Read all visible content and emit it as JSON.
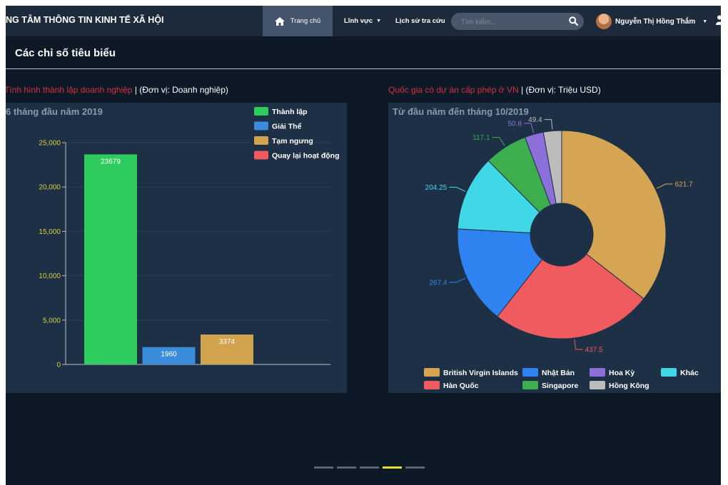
{
  "navbar": {
    "brand": "NG TÂM THÔNG TIN KINH TẾ XÃ HỘI",
    "home_label": "Trang chủ",
    "field_label": "Lĩnh vực",
    "history_label": "Lịch sử tra cứu",
    "search_placeholder": "Tìm kiếm...",
    "user_name": "Nguyễn Thị Hồng Thắm",
    "icons": [
      "home-icon",
      "search-icon",
      "user-icon"
    ]
  },
  "section": {
    "title": "Các chỉ số tiêu biểu"
  },
  "panels": {
    "left": {
      "title_red": "Tình hình thành lập doanh nghiệp",
      "title_rest": " | (Đơn vị: Doanh nghiệp)"
    },
    "right": {
      "title_red": "Quốc gia có dự án cấp phép ở VN",
      "title_rest": " | (Đơn vị: Triệu USD)"
    }
  },
  "colors": {
    "green": "#2ecc5f",
    "blue": "#3b8ddb",
    "gold": "#d1a34e",
    "red": "#ef5a5f",
    "pie_gold": "#d6a553",
    "pie_red": "#ef5b5e",
    "pie_blue": "#2f83f0",
    "pie_cyan": "#40d7e6",
    "pie_green": "#3cae4e",
    "pie_purple": "#8c6fd9",
    "pie_gray": "#bcbcbc"
  },
  "chart_data": [
    {
      "type": "bar",
      "title": "6 tháng đầu năm 2019",
      "categories": [
        "Thành lập",
        "Giải Thể",
        "Tạm ngưng",
        "Quay lại hoạt động"
      ],
      "values": [
        23679,
        1960,
        3374,
        0
      ],
      "data_labels": [
        "23679",
        "1960",
        "3374",
        ""
      ],
      "colors": [
        "#2ecc5f",
        "#3b8ddb",
        "#d1a34e",
        "#ef5a5f"
      ],
      "legend": [
        "Thành lập",
        "Giải Thể",
        "Tạm ngưng",
        "Quay lại hoạt động"
      ],
      "legend_position": "top-right",
      "ylim": [
        0,
        25000
      ],
      "yticks": [
        0,
        5000,
        10000,
        15000,
        20000,
        25000
      ],
      "ytick_labels": [
        "0",
        "5,000",
        "10,000",
        "15,000",
        "20,000",
        "25,000"
      ],
      "grid": true
    },
    {
      "type": "pie",
      "title": "Từ đầu năm đến tháng 10/2019",
      "labels": [
        "British Virgin Islands",
        "Hàn Quốc",
        "Nhật Bản",
        "Khác",
        "Singapore",
        "Hoa Kỳ",
        "Hồng Kông"
      ],
      "values": [
        621.7,
        437.5,
        267.4,
        204.25,
        117.1,
        50.8,
        49.4
      ],
      "data_labels": [
        "621.7",
        "437.5",
        "267.4",
        "204.25",
        "117.1",
        "50.8",
        "49.4"
      ],
      "colors": [
        "#d6a553",
        "#ef5b5e",
        "#2f83f0",
        "#40d7e6",
        "#3cae4e",
        "#8c6fd9",
        "#bcbcbc"
      ],
      "legend": [
        "British Virgin Islands",
        "Nhật Bản",
        "Hoa Kỳ",
        "Khác",
        "Hàn Quốc",
        "Singapore",
        "Hồng Kông"
      ],
      "legend_colors": [
        "#d6a553",
        "#2f83f0",
        "#8c6fd9",
        "#40d7e6",
        "#ef5b5e",
        "#3cae4e",
        "#bcbcbc"
      ],
      "legend_position": "bottom",
      "donut": true
    }
  ],
  "carousel": {
    "count": 5,
    "active": 3
  }
}
